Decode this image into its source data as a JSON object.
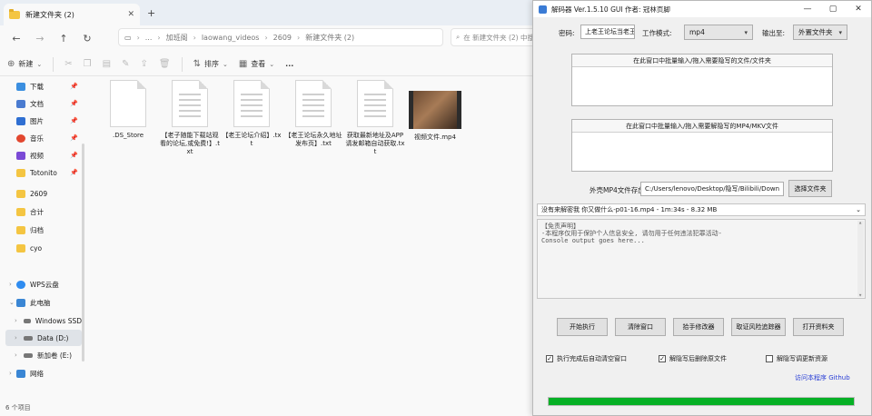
{
  "explorer": {
    "tab_title": "新建文件夹 (2)",
    "breadcrumb": [
      "...",
      "加班阁",
      "laowang_videos",
      "2609",
      "新建文件夹 (2)"
    ],
    "search_placeholder": "在 新建文件夹 (2) 中搜索",
    "toolbar": {
      "new_label": "新建",
      "sort_label": "排序",
      "view_label": "查看",
      "more_label": "..."
    },
    "sidebar": [
      {
        "label": "下载",
        "pinned": true,
        "color": "#3b8fe0"
      },
      {
        "label": "文档",
        "pinned": true,
        "color": "#4a7bd0"
      },
      {
        "label": "图片",
        "pinned": true,
        "color": "#2f6fd2"
      },
      {
        "label": "音乐",
        "pinned": true,
        "color": "#e2472f"
      },
      {
        "label": "视频",
        "pinned": true,
        "color": "#7b4ad6"
      },
      {
        "label": "Totonito",
        "pinned": true,
        "color": "#f4c542"
      },
      {
        "label": "2609",
        "pinned": false,
        "color": "#f4c542"
      },
      {
        "label": "合计",
        "pinned": false,
        "color": "#f4c542"
      },
      {
        "label": "归档",
        "pinned": false,
        "color": "#f4c542"
      },
      {
        "label": "cyo",
        "pinned": false,
        "color": "#f4c542"
      }
    ],
    "tree": [
      {
        "label": "WPS云盘",
        "color": "#2f8cf0",
        "expanded": false
      },
      {
        "label": "此电脑",
        "color": "#3a86d4",
        "expanded": true
      },
      {
        "label": "Windows SSD",
        "color": "#777777",
        "expanded": false
      },
      {
        "label": "Data (D:)",
        "color": "#777777",
        "expanded": false,
        "selected": true
      },
      {
        "label": "新加卷 (E:)",
        "color": "#777777",
        "expanded": false
      },
      {
        "label": "网络",
        "color": "#3a86d4",
        "expanded": false
      }
    ],
    "files": [
      {
        "name": ".DS_Store",
        "kind": "blank"
      },
      {
        "name": "【老子随能下载站观看的论坛,或免费!】.txt",
        "kind": "text"
      },
      {
        "name": "【老王论坛介绍】.txt",
        "kind": "text"
      },
      {
        "name": "【老王论坛永久地址发布页】.txt",
        "kind": "text"
      },
      {
        "name": "获取最新地址及APP请发邮箱自动获取.txt",
        "kind": "text"
      },
      {
        "name": "视频文件.mp4",
        "kind": "video"
      }
    ],
    "status": "6 个项目"
  },
  "app": {
    "title": "解码器 Ver.1.5.10 GUI 作者: 冠林页脚",
    "password_label": "密码:",
    "password_value": "上老王论坛当老王",
    "mode_label": "工作模式:",
    "mode_value": "mp4",
    "output_label": "输出至:",
    "output_value": "外置文件夹",
    "drop1_label": "在此窗口中批量输入/拖入需要隐写的文件/文件夹",
    "drop2_label": "在此窗口中批量输入/拖入需要解隐写的MP4/MKV文件",
    "mp4_path_label": "外壳MP4文件存放:",
    "mp4_path_value": "C:/Users/lenovo/Desktop/隐写/Bilibili/Down",
    "choose_folder_label": "选择文件夹",
    "selected_file": "没有来解密我 你又做什么-p01-16.mp4 - 1m:34s - 8.32 MB",
    "console_lines": [
      "【免责声明】",
      "-本程序仅用于保护个人信息安全, 请勿用于任何违法犯罪活动-",
      "Console output goes here..."
    ],
    "buttons": [
      "开始执行",
      "清除窗口",
      "拾手修改器",
      "取证风险追踪器",
      "打开资料夹"
    ],
    "checkboxes": [
      {
        "label": "执行完成后自动清空窗口",
        "checked": true
      },
      {
        "label": "解隐写后删除原文件",
        "checked": true
      },
      {
        "label": "解隐写调更新资源",
        "checked": false
      }
    ],
    "link_text": "访问本程序 Github",
    "progress": 1.0,
    "accent_progress": "#06b025"
  }
}
